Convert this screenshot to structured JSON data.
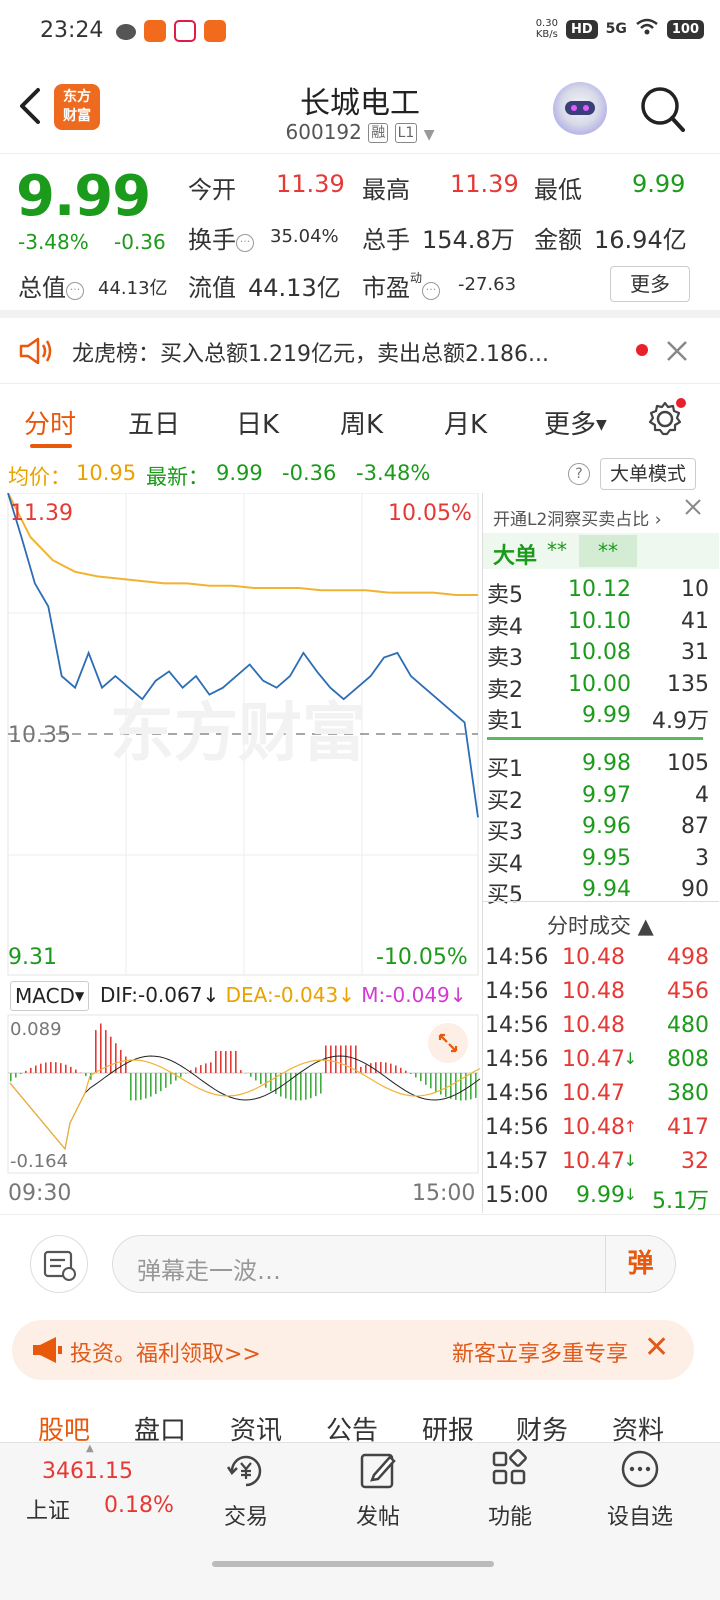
{
  "status": {
    "time": "23:24",
    "net_speed_top": "0.30",
    "net_speed_bot": "KB/s",
    "hd": "HD",
    "signal": "5G",
    "battery": "100"
  },
  "header": {
    "title": "长城电工",
    "code": "600192",
    "tag_rong": "融",
    "tag_level": "L1",
    "logo_top": "东方",
    "logo_bot": "财富"
  },
  "quote": {
    "price": "9.99",
    "change_pct": "-3.48%",
    "change": "-0.36",
    "open_label": "今开",
    "open": "11.39",
    "high_label": "最高",
    "high": "11.39",
    "low_label": "最低",
    "low": "9.99",
    "turnover_label": "换手",
    "turnover": "35.04%",
    "volume_label": "总手",
    "volume": "154.8万",
    "amount_label": "金额",
    "amount": "16.94亿",
    "mktcap_label": "总值",
    "mktcap": "44.13亿",
    "float_label": "流值",
    "float": "44.13亿",
    "pe_label": "市盈",
    "pe_sup": "动",
    "pe": "-27.63",
    "more": "更多"
  },
  "notice": {
    "text": "龙虎榜：买入总额1.219亿元，卖出总额2.186..."
  },
  "tabs": [
    {
      "label": "分时"
    },
    {
      "label": "五日"
    },
    {
      "label": "日K"
    },
    {
      "label": "周K"
    },
    {
      "label": "月K"
    },
    {
      "label": "更多"
    }
  ],
  "avgbar": {
    "avg_label": "均价：",
    "avg": "10.95",
    "last_label": "最新：",
    "last": "9.99",
    "chg": "-0.36",
    "pct": "-3.48%",
    "mode": "大单模式"
  },
  "chart": {
    "y_max": "11.39",
    "y_mid": "10.35",
    "y_min": "9.31",
    "pct_max": "10.05%",
    "pct_min": "-10.05%",
    "x_start": "09:30",
    "x_end": "15:00",
    "macd_label": "MACD",
    "dif": "DIF:-0.067",
    "dea": "DEA:-0.043",
    "m": "M:-0.049",
    "macd_max": "0.089",
    "macd_min": "-0.164",
    "watermark": "东方财富"
  },
  "chart_data": {
    "type": "line",
    "title": "",
    "ylim": [
      9.31,
      11.39
    ],
    "x": [
      "09:30",
      "15:00"
    ],
    "series": [
      {
        "name": "",
        "color": "#2d6db5",
        "values": [
          11.39,
          11.2,
          11.0,
          10.9,
          10.6,
          10.55,
          10.7,
          10.55,
          10.6,
          10.55,
          10.5,
          10.58,
          10.62,
          10.55,
          10.6,
          10.52,
          10.55,
          10.6,
          10.65,
          10.58,
          10.55,
          10.6,
          10.7,
          10.62,
          10.55,
          10.5,
          10.55,
          10.6,
          10.68,
          10.7,
          10.6,
          10.55,
          10.5,
          10.45,
          10.4,
          9.99
        ]
      },
      {
        "name": "",
        "color": "#f2b233",
        "values": [
          11.39,
          11.2,
          11.1,
          11.05,
          11.03,
          11.02,
          11.01,
          11.0,
          11.0,
          10.99,
          10.99,
          10.98,
          10.98,
          10.98,
          10.97,
          10.97,
          10.97,
          10.96,
          10.96,
          10.96,
          10.95,
          10.95
        ]
      }
    ]
  },
  "orderbook": {
    "l2_text": "开通L2洞察买卖占比",
    "big_label": "大单",
    "big_v1": "**",
    "big_v2": "**",
    "asks": [
      {
        "label": "卖5",
        "price": "10.12",
        "vol": "10"
      },
      {
        "label": "卖4",
        "price": "10.10",
        "vol": "41"
      },
      {
        "label": "卖3",
        "price": "10.08",
        "vol": "31"
      },
      {
        "label": "卖2",
        "price": "10.00",
        "vol": "135"
      },
      {
        "label": "卖1",
        "price": "9.99",
        "vol": "4.9万"
      }
    ],
    "bids": [
      {
        "label": "买1",
        "price": "9.98",
        "vol": "105"
      },
      {
        "label": "买2",
        "price": "9.97",
        "vol": "4"
      },
      {
        "label": "买3",
        "price": "9.96",
        "vol": "87"
      },
      {
        "label": "买4",
        "price": "9.95",
        "vol": "3"
      },
      {
        "label": "买5",
        "price": "9.94",
        "vol": "90"
      }
    ],
    "trades_title": "分时成交",
    "trades": [
      {
        "time": "14:56",
        "price": "10.48",
        "arrow": "",
        "vol": "498"
      },
      {
        "time": "14:56",
        "price": "10.48",
        "arrow": "",
        "vol": "456"
      },
      {
        "time": "14:56",
        "price": "10.48",
        "arrow": "",
        "vol": "480"
      },
      {
        "time": "14:56",
        "price": "10.47",
        "arrow": "↓",
        "vol": "808"
      },
      {
        "time": "14:56",
        "price": "10.47",
        "arrow": "",
        "vol": "380"
      },
      {
        "time": "14:56",
        "price": "10.48",
        "arrow": "↑",
        "vol": "417"
      },
      {
        "time": "14:57",
        "price": "10.47",
        "arrow": "↓",
        "vol": "32"
      },
      {
        "time": "15:00",
        "price": "9.99",
        "arrow": "↓",
        "vol": "5.1万"
      }
    ]
  },
  "danmu": {
    "placeholder": "弹幕走一波…",
    "btn": "弹"
  },
  "promo": {
    "a": "投资。福利领取>>",
    "b": "新客立享多重专享"
  },
  "bottom_tabs": [
    {
      "label": "股吧"
    },
    {
      "label": "盘口"
    },
    {
      "label": "资讯"
    },
    {
      "label": "公告"
    },
    {
      "label": "研报"
    },
    {
      "label": "财务"
    },
    {
      "label": "资料"
    }
  ],
  "footer": {
    "index_value": "3461.15",
    "index_name": "上证",
    "index_pct": "0.18%",
    "trade": "交易",
    "post": "发帖",
    "func": "功能",
    "watch": "设自选"
  }
}
